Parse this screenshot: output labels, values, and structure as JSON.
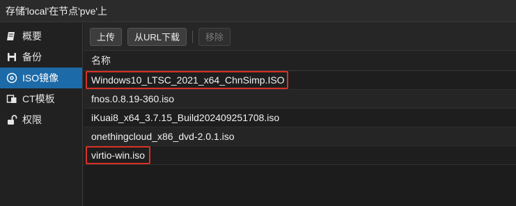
{
  "title": "存储'local'在节点'pve'上",
  "sidebar": {
    "items": [
      {
        "label": "概要",
        "icon": "book-icon",
        "active": false
      },
      {
        "label": "备份",
        "icon": "floppy-icon",
        "active": false
      },
      {
        "label": "ISO镜像",
        "icon": "disc-icon",
        "active": true
      },
      {
        "label": "CT模板",
        "icon": "container-icon",
        "active": false
      },
      {
        "label": "权限",
        "icon": "unlock-icon",
        "active": false
      }
    ]
  },
  "toolbar": {
    "upload_label": "上传",
    "download_url_label": "从URL下载",
    "remove_label": "移除"
  },
  "table": {
    "column_name": "名称",
    "rows": [
      {
        "name": "Windows10_LTSC_2021_x64_ChnSimp.ISO",
        "highlighted": true
      },
      {
        "name": "fnos.0.8.19-360.iso",
        "highlighted": false
      },
      {
        "name": "iKuai8_x64_3.7.15_Build202409251708.iso",
        "highlighted": false
      },
      {
        "name": "onethingcloud_x86_dvd-2.0.1.iso",
        "highlighted": false
      },
      {
        "name": "virtio-win.iso",
        "highlighted": true
      }
    ]
  },
  "colors": {
    "active_nav": "#1c6aa8",
    "highlight_box": "#d93025"
  }
}
